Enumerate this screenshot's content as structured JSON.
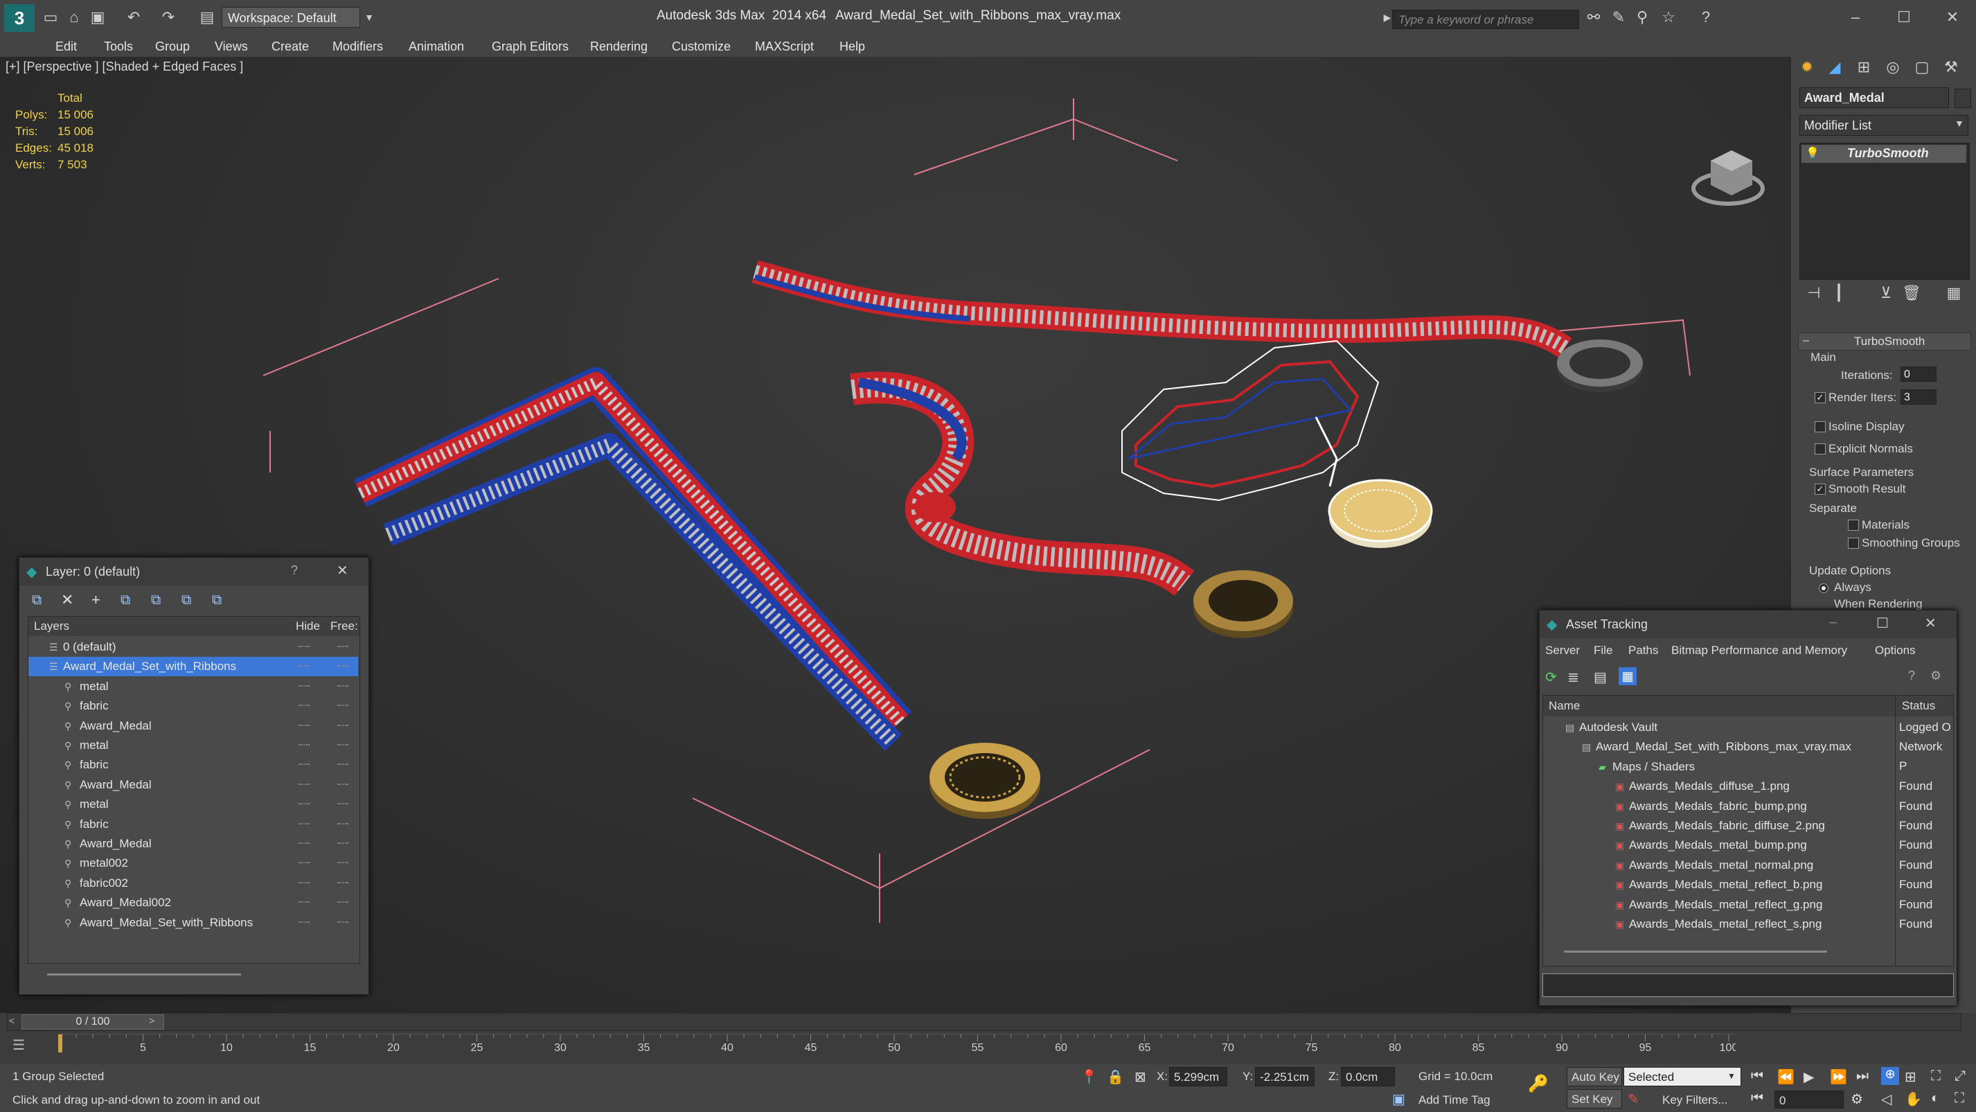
{
  "titlebar": {
    "app": "Autodesk 3ds Max  2014 x64",
    "file": "Award_Medal_Set_with_Ribbons_max_vray.max",
    "workspace": "Workspace: Default",
    "search_placeholder": "Type a keyword or phrase"
  },
  "menu": [
    "Edit",
    "Tools",
    "Group",
    "Views",
    "Create",
    "Modifiers",
    "Animation",
    "Graph Editors",
    "Rendering",
    "Customize",
    "MAXScript",
    "Help"
  ],
  "viewport": {
    "label": "[+] [Perspective ] [Shaded + Edged Faces ]",
    "stats": {
      "header": "Total",
      "rows": [
        {
          "label": "Polys:",
          "value": "15 006"
        },
        {
          "label": "Tris:",
          "value": "15 006"
        },
        {
          "label": "Edges:",
          "value": "45 018"
        },
        {
          "label": "Verts:",
          "value": "7 503"
        }
      ]
    }
  },
  "command_panel": {
    "object_name": "Award_Medal",
    "modifier_list": "Modifier List",
    "stack_item": "TurboSmooth",
    "rollout_title": "TurboSmooth",
    "main": "Main",
    "iterations_label": "Iterations:",
    "iterations_value": "0",
    "render_iters_label": "Render Iters:",
    "render_iters_value": "3",
    "isoline": "Isoline Display",
    "explicit_normals": "Explicit Normals",
    "surface_params": "Surface Parameters",
    "smooth_result": "Smooth Result",
    "separate": "Separate",
    "materials": "Materials",
    "smoothing_groups": "Smoothing Groups",
    "update_options": "Update Options",
    "always": "Always",
    "when_rendering": "When Rendering"
  },
  "layer_window": {
    "title": "Layer: 0 (default)",
    "help": "?",
    "columns": {
      "layers": "Layers",
      "hide": "Hide",
      "freeze": "Free:"
    },
    "rows": [
      {
        "name": "0 (default)",
        "level": 0
      },
      {
        "name": "Award_Medal_Set_with_Ribbons",
        "level": 0,
        "selected": true
      },
      {
        "name": "metal",
        "level": 1
      },
      {
        "name": "fabric",
        "level": 1
      },
      {
        "name": "Award_Medal",
        "level": 1
      },
      {
        "name": "metal",
        "level": 1
      },
      {
        "name": "fabric",
        "level": 1
      },
      {
        "name": "Award_Medal",
        "level": 1
      },
      {
        "name": "metal",
        "level": 1
      },
      {
        "name": "fabric",
        "level": 1
      },
      {
        "name": "Award_Medal",
        "level": 1
      },
      {
        "name": "metal002",
        "level": 1
      },
      {
        "name": "fabric002",
        "level": 1
      },
      {
        "name": "Award_Medal002",
        "level": 1
      },
      {
        "name": "Award_Medal_Set_with_Ribbons",
        "level": 1
      }
    ]
  },
  "asset_window": {
    "title": "Asset Tracking",
    "menu": [
      "Server",
      "File",
      "Paths",
      "Bitmap Performance and Memory",
      "Options"
    ],
    "columns": {
      "name": "Name",
      "status": "Status"
    },
    "rows": [
      {
        "name": "Autodesk Vault",
        "status": "Logged O",
        "level": 0
      },
      {
        "name": "Award_Medal_Set_with_Ribbons_max_vray.max",
        "status": "Network P",
        "level": 1
      },
      {
        "name": "Maps / Shaders",
        "status": "",
        "level": 2
      },
      {
        "name": "Awards_Medals_diffuse_1.png",
        "status": "Found",
        "level": 3
      },
      {
        "name": "Awards_Medals_fabric_bump.png",
        "status": "Found",
        "level": 3
      },
      {
        "name": "Awards_Medals_fabric_diffuse_2.png",
        "status": "Found",
        "level": 3
      },
      {
        "name": "Awards_Medals_metal_bump.png",
        "status": "Found",
        "level": 3
      },
      {
        "name": "Awards_Medals_metal_normal.png",
        "status": "Found",
        "level": 3
      },
      {
        "name": "Awards_Medals_metal_reflect_b.png",
        "status": "Found",
        "level": 3
      },
      {
        "name": "Awards_Medals_metal_reflect_g.png",
        "status": "Found",
        "level": 3
      },
      {
        "name": "Awards_Medals_metal_reflect_s.png",
        "status": "Found",
        "level": 3
      }
    ]
  },
  "timeline": {
    "frame": "0 / 100",
    "ticks": [
      "5",
      "10",
      "15",
      "20",
      "25",
      "30",
      "35",
      "40",
      "45",
      "50",
      "55",
      "60",
      "65",
      "70",
      "75",
      "80",
      "85",
      "90",
      "95",
      "100"
    ]
  },
  "status": {
    "selection": "1 Group Selected",
    "hint": "Click and drag up-and-down to zoom in and out",
    "x_label": "X:",
    "x": "5.299cm",
    "y_label": "Y:",
    "y": "-2.251cm",
    "z_label": "Z:",
    "z": "0.0cm",
    "grid": "Grid = 10.0cm",
    "auto_key": "Auto Key",
    "selected": "Selected",
    "set_key": "Set Key",
    "key_filters": "Key Filters...",
    "add_time_tag": "Add Time Tag",
    "frame_field": "0"
  },
  "colors": {
    "accent": "#3b78d8",
    "stats": "#f0d24a",
    "ribbon_red": "#c8242a",
    "ribbon_blue": "#1f3ea8",
    "medal_gold": "#c9a24a"
  }
}
